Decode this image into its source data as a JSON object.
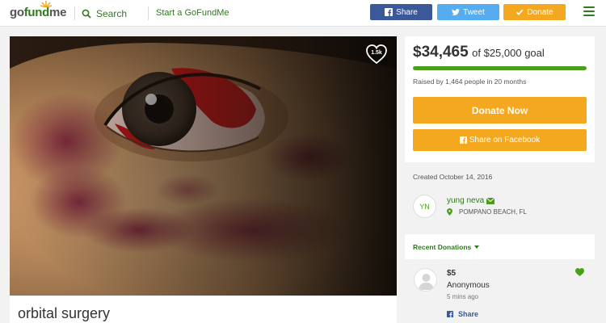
{
  "header": {
    "logo_go": "go",
    "logo_fund": "fund",
    "logo_me": "me",
    "search_label": "Search",
    "start_link": "Start a GoFundMe",
    "share_label": "Share",
    "tweet_label": "Tweet",
    "donate_label": "Donate"
  },
  "campaign": {
    "title": "orbital surgery",
    "hearts": "1.5k",
    "raised": "$34,465",
    "goal_text": "of $25,000 goal",
    "progress_percent": 100,
    "raised_by": "Raised by 1,464 people in 20 months",
    "donate_now": "Donate Now",
    "share_facebook": "Share on Facebook",
    "created": "Created October 14, 2016"
  },
  "organizer": {
    "initials": "YN",
    "name": "yung neva",
    "location": "POMPANO BEACH, FL"
  },
  "donations": {
    "section_label": "Recent Donations",
    "items": [
      {
        "amount": "$5",
        "name": "Anonymous",
        "time": "5 mins ago",
        "share": "Share"
      }
    ]
  },
  "colors": {
    "brand_green": "#2f7a1f",
    "facebook": "#3b5998",
    "twitter": "#55acee",
    "donate_orange": "#f4a820",
    "progress_green": "#4a9e1c"
  }
}
